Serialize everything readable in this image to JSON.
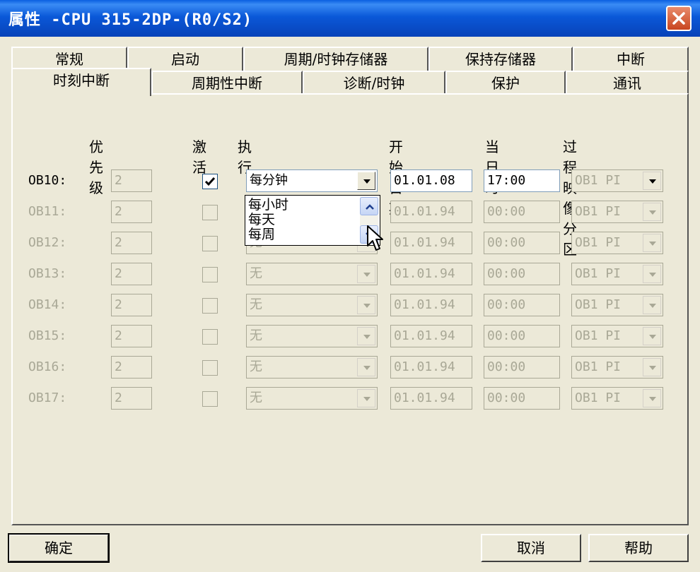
{
  "window": {
    "title": "属性 -CPU 315-2DP-(R0/S2)"
  },
  "tabs_back": [
    {
      "label": "常规"
    },
    {
      "label": "启动"
    },
    {
      "label": "周期/时钟存储器"
    },
    {
      "label": "保持存储器"
    },
    {
      "label": "中断"
    }
  ],
  "tabs_front": [
    {
      "label": "时刻中断"
    },
    {
      "label": "周期性中断"
    },
    {
      "label": "诊断/时钟"
    },
    {
      "label": "保护"
    },
    {
      "label": "通讯"
    }
  ],
  "active_tab": "时刻中断",
  "columns": {
    "priority": "优先级",
    "active": "激活",
    "execute": "执行",
    "start_date": "开始日期",
    "time_of_day": "当日时间",
    "process_image": "过程映像分区"
  },
  "rows": [
    {
      "ob": "OB10:",
      "priority": "2",
      "active": true,
      "execute": "每分钟",
      "date": "01.01.08",
      "time": "17:00",
      "pi": "OB1 PI",
      "enabled": true
    },
    {
      "ob": "OB11:",
      "priority": "2",
      "active": false,
      "execute": "",
      "date": "01.01.94",
      "time": "00:00",
      "pi": "OB1 PI",
      "enabled": false
    },
    {
      "ob": "OB12:",
      "priority": "2",
      "active": false,
      "execute": "无",
      "date": "01.01.94",
      "time": "00:00",
      "pi": "OB1 PI",
      "enabled": false
    },
    {
      "ob": "OB13:",
      "priority": "2",
      "active": false,
      "execute": "无",
      "date": "01.01.94",
      "time": "00:00",
      "pi": "OB1 PI",
      "enabled": false
    },
    {
      "ob": "OB14:",
      "priority": "2",
      "active": false,
      "execute": "无",
      "date": "01.01.94",
      "time": "00:00",
      "pi": "OB1 PI",
      "enabled": false
    },
    {
      "ob": "OB15:",
      "priority": "2",
      "active": false,
      "execute": "无",
      "date": "01.01.94",
      "time": "00:00",
      "pi": "OB1 PI",
      "enabled": false
    },
    {
      "ob": "OB16:",
      "priority": "2",
      "active": false,
      "execute": "无",
      "date": "01.01.94",
      "time": "00:00",
      "pi": "OB1 PI",
      "enabled": false
    },
    {
      "ob": "OB17:",
      "priority": "2",
      "active": false,
      "execute": "无",
      "date": "01.01.94",
      "time": "00:00",
      "pi": "OB1 PI",
      "enabled": false
    }
  ],
  "dropdown_options": [
    "每小时",
    "每天",
    "每周"
  ],
  "buttons": {
    "ok": "确定",
    "cancel": "取消",
    "help": "帮助"
  },
  "icons": {
    "close": "close-icon",
    "dropdown": "chevron-down-icon",
    "scroll_up": "chevron-up-icon",
    "scroll_down": "chevron-down-icon",
    "checkbox": "checkmark-icon",
    "cursor": "mouse-pointer-icon"
  },
  "colors": {
    "titlebar": "#0a58d8",
    "dialog_bg": "#ece9d8",
    "disabled_text": "#a9a896",
    "close_button": "#c9451f"
  }
}
